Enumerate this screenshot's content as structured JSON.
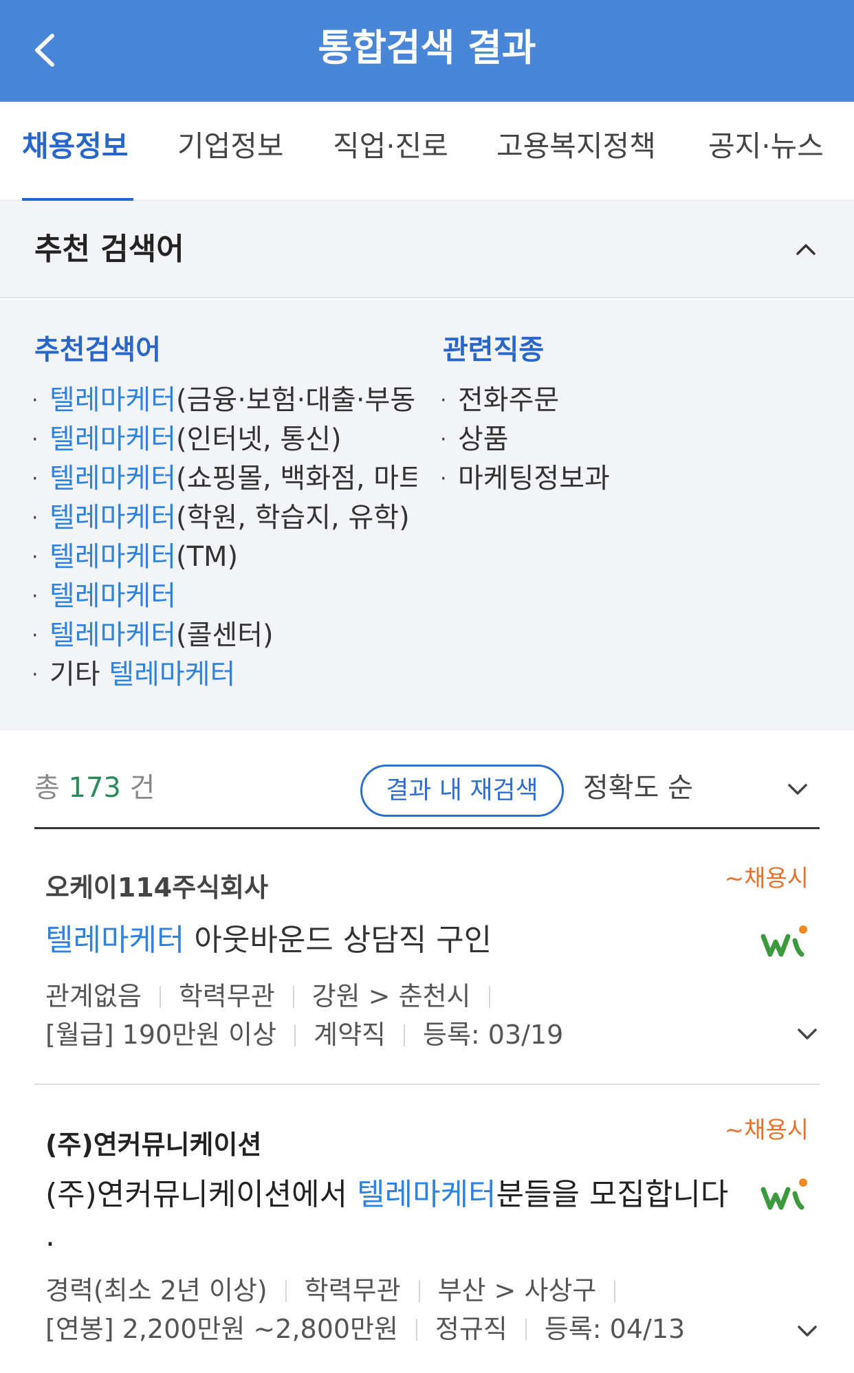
{
  "header": {
    "title": "통합검색 결과"
  },
  "tabs": [
    {
      "label": "채용정보",
      "active": true
    },
    {
      "label": "기업정보",
      "active": false
    },
    {
      "label": "직업·진로",
      "active": false
    },
    {
      "label": "고용복지정책",
      "active": false
    },
    {
      "label": "공지·뉴스",
      "active": false
    }
  ],
  "recommend": {
    "section_title": "추천 검색어",
    "left_title": "추천검색어",
    "right_title": "관련직종",
    "left_items": [
      {
        "highlight": "텔레마케터",
        "rest": "(금융·보험·대출·부동"
      },
      {
        "highlight": "텔레마케터",
        "rest": "(인터넷, 통신)"
      },
      {
        "highlight": "텔레마케터",
        "rest": "(쇼핑몰, 백화점, 마트"
      },
      {
        "highlight": "텔레마케터",
        "rest": "(학원, 학습지, 유학)"
      },
      {
        "highlight": "텔레마케터",
        "rest": "(TM)"
      },
      {
        "highlight": "텔레마케터",
        "rest": ""
      },
      {
        "highlight": "텔레마케터",
        "rest": "(콜센터)"
      },
      {
        "prefix": "기타 ",
        "highlight": "텔레마케터",
        "rest": ""
      }
    ],
    "right_items": [
      "전화주문",
      "상품",
      "마케팅정보과"
    ]
  },
  "results": {
    "total_prefix": "총",
    "total_count": "173",
    "total_suffix": "건",
    "research_label": "결과 내 재검색",
    "sort_label": "정확도 순"
  },
  "jobs": [
    {
      "company": "오케이114주식회사",
      "deadline": "~채용시",
      "title_highlight": "텔레마케터",
      "title_rest": " 아웃바운드 상담직 구인",
      "experience": "관계없음",
      "education": "학력무관",
      "location": "강원 > 춘천시",
      "salary": "[월급] 190만원 이상",
      "employment_type": "계약직",
      "registered": "등록: 03/19"
    },
    {
      "company": "(주)연커뮤니케이션",
      "deadline": "~채용시",
      "title_prefix": "(주)연커뮤니케이션에서 ",
      "title_highlight": "텔레마케터",
      "title_rest": "분들을 모집합니다",
      "title_line2": ".",
      "experience": "경력(최소 2년 이상)",
      "education": "학력무관",
      "location": "부산 > 사상구",
      "salary": "[연봉] 2,200만원 ~2,800만원",
      "employment_type": "정규직",
      "registered": "등록: 04/13"
    }
  ],
  "colors": {
    "header_bg": "#4A86D8",
    "accent_blue": "#2867c9",
    "highlight_blue": "#2f83e0",
    "count_green": "#2a8a5a",
    "deadline_orange": "#e8722c",
    "panel_bg": "#f2f4f7"
  },
  "icons": {
    "back": "back-arrow-icon",
    "collapse": "chevron-up-icon",
    "sort": "chevron-down-icon",
    "expand": "chevron-down-icon",
    "source": "worknet-logo"
  }
}
